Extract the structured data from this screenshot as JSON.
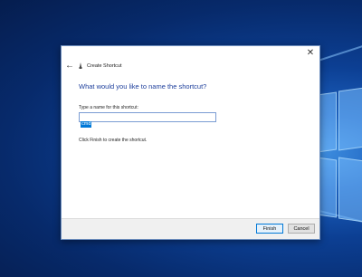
{
  "window": {
    "title": "Create Shortcut",
    "back_icon": "back-arrow-icon",
    "close_icon": "close-icon"
  },
  "content": {
    "heading": "What would you like to name the shortcut?",
    "field_label": "Type a name for this shortcut:",
    "name_value": "cmd",
    "hint": "Click Finish to create the shortcut."
  },
  "buttons": {
    "finish": "Finish",
    "cancel": "Cancel"
  },
  "colors": {
    "heading": "#1e3f9c",
    "selection": "#0078d7",
    "desktop": "#0c3f93"
  }
}
